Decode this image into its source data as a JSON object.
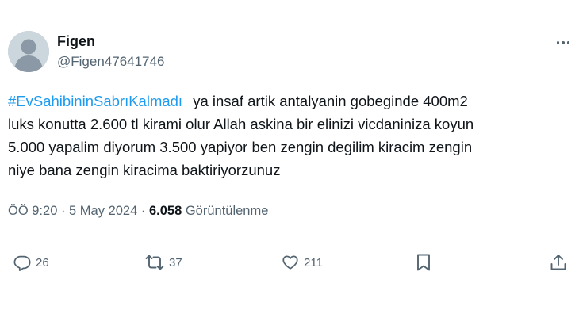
{
  "author": {
    "display_name": "Figen",
    "handle": "@Figen47641746"
  },
  "tweet": {
    "hashtag": "#EvSahibininSabrıKalmadı",
    "line1_rest": "ya insaf artik antalyanin gobeginde 400m2",
    "line2": "luks konutta 2.600 tl kirami olur Allah askina bir elinizi vicdaniniza koyun",
    "line3": "5.000 yapalim diyorum 3.500 yapiyor ben zengin degilim kiracim zengin",
    "line4": "niye bana zengin kiracima baktiriyorzunuz"
  },
  "meta": {
    "time": "ÖÖ 9:20",
    "sep1": " · ",
    "date": "5 May 2024",
    "sep2": " · ",
    "views_count": "6.058",
    "views_label": " Görüntülenme"
  },
  "actions": {
    "reply_count": "26",
    "retweet_count": "37",
    "like_count": "211"
  },
  "icons": {
    "avatar": "default-avatar-icon",
    "more": "more-dots-icon",
    "reply": "reply-bubble-icon",
    "retweet": "retweet-arrows-icon",
    "like": "heart-icon",
    "bookmark": "bookmark-icon",
    "share": "share-upload-icon"
  },
  "colors": {
    "link": "#1d9bf0",
    "secondary_text": "#536471",
    "primary_text": "#0f1419",
    "divider": "#cfd9de",
    "avatar_bg": "#ccd6dd"
  }
}
